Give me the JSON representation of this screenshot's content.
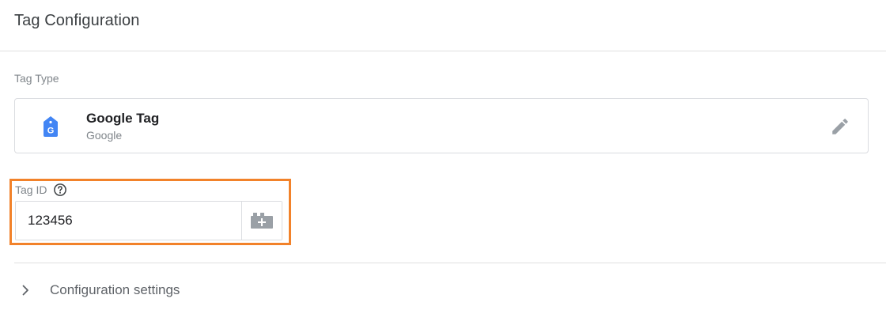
{
  "header": {
    "title": "Tag Configuration"
  },
  "tag_type": {
    "label": "Tag Type",
    "name": "Google Tag",
    "vendor": "Google",
    "icon": "google-tag-icon",
    "edit_icon": "pencil-icon"
  },
  "tag_id": {
    "label": "Tag ID",
    "help_icon": "question-circle-icon",
    "value": "123456",
    "variable_icon": "add-variable-icon"
  },
  "configuration_settings": {
    "label": "Configuration settings",
    "icon": "chevron-right-icon"
  },
  "colors": {
    "highlight": "#f2822a",
    "google_blue": "#4285f4",
    "border": "#dadce0",
    "muted_text": "#80868b"
  }
}
